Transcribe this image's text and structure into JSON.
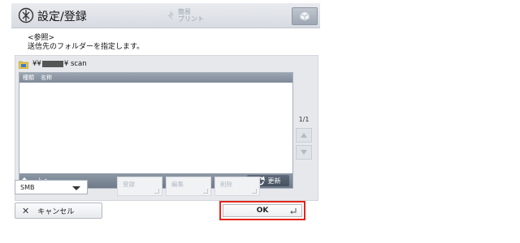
{
  "header": {
    "title": "設定/登録",
    "quick_print": "簡易\nプリント",
    "menu_icon": "settings-register-icon",
    "settings_icon": "cube-icon"
  },
  "instruction": {
    "line1": "<参照>",
    "line2": "送信先のフォルダーを指定します。"
  },
  "browser": {
    "path_prefix": "¥¥",
    "path_suffix": "¥ scan",
    "columns": [
      "種類",
      "名称"
    ],
    "up_label": "上へ",
    "refresh_label": "更新",
    "page": "1/1"
  },
  "controls": {
    "protocol_value": "SMB",
    "register_label": "登録",
    "edit_label": "編集",
    "delete_label": "削除"
  },
  "footer": {
    "cancel_label": "キャンセル",
    "ok_label": "OK"
  },
  "colors": {
    "highlight": "#e1251b",
    "header_bg": "#d7dbe2"
  }
}
